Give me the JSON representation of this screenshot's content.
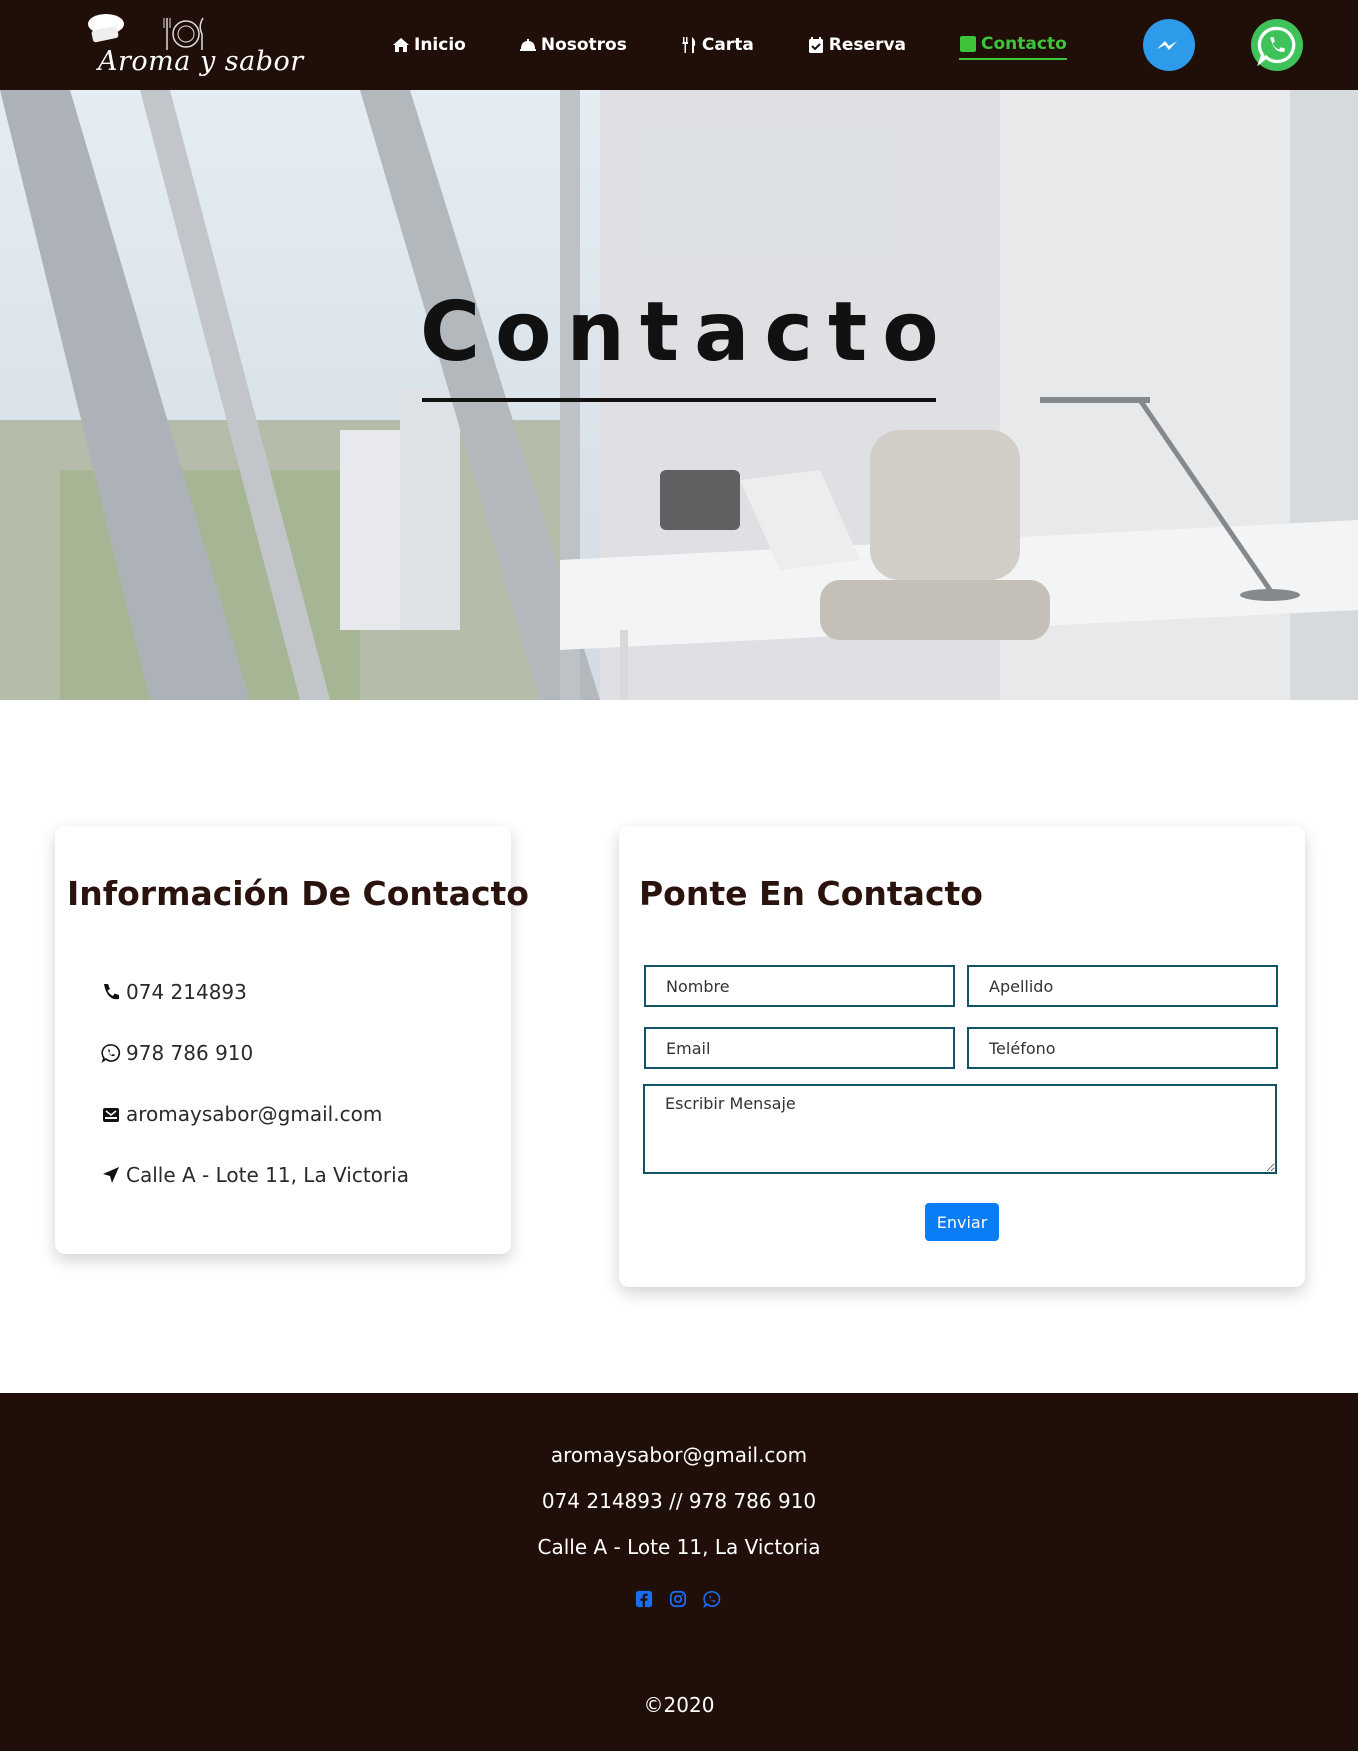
{
  "nav": {
    "logo_text": "Aroma y sabor",
    "items": [
      {
        "label": "Inicio",
        "icon": "home-icon"
      },
      {
        "label": "Nosotros",
        "icon": "service-bell-icon"
      },
      {
        "label": "Carta",
        "icon": "utensils-icon"
      },
      {
        "label": "Reserva",
        "icon": "calendar-check-icon"
      },
      {
        "label": "Contacto",
        "icon": "phone-square-icon",
        "active": true
      }
    ],
    "float_icons": [
      "messenger-icon",
      "whatsapp-icon"
    ]
  },
  "hero": {
    "title": "Contacto"
  },
  "contact_info": {
    "title": "Información De Contacto",
    "items": [
      {
        "icon": "phone-icon",
        "text": "074 214893"
      },
      {
        "icon": "whatsapp-icon",
        "text": "978 786 910"
      },
      {
        "icon": "mail-box-icon",
        "text": "aromaysabor@gmail.com"
      },
      {
        "icon": "location-arrow-icon",
        "text": "Calle A - Lote 11, La Victoria"
      }
    ]
  },
  "form": {
    "title": "Ponte En Contacto",
    "nombre_placeholder": "Nombre",
    "apellido_placeholder": "Apellido",
    "email_placeholder": "Email",
    "telefono_placeholder": "Teléfono",
    "mensaje_placeholder": "Escribir Mensaje",
    "submit_label": "Enviar"
  },
  "footer": {
    "email": "aromaysabor@gmail.com",
    "phones": "074 214893 // 978 786 910",
    "address": "Calle A - Lote 11, La Victoria",
    "social_icons": [
      "facebook-icon",
      "instagram-icon",
      "whatsapp-icon"
    ],
    "copyright": "©2020"
  },
  "colors": {
    "nav_bg": "#200e08",
    "active_link": "#3ec43a",
    "field_border": "#0f5467",
    "button": "#0a7cf5",
    "footer_icons": "#1a6cf0"
  }
}
